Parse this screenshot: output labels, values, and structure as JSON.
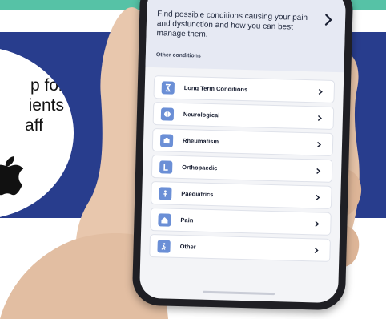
{
  "badge": {
    "lines": [
      "p for",
      "ients",
      "aff"
    ],
    "icon": "apple-logo-icon"
  },
  "phone": {
    "top_card_text": "Find possible conditions causing your pain and dysfunction and how you can best manage them.",
    "section_label": "Other conditions",
    "items": [
      {
        "label": "Long Term Conditions",
        "icon": "hourglass-icon"
      },
      {
        "label": "Neurological",
        "icon": "brain-icon"
      },
      {
        "label": "Rheumatism",
        "icon": "medical-kit-icon"
      },
      {
        "label": "Orthopaedic",
        "icon": "bone-icon"
      },
      {
        "label": "Paediatrics",
        "icon": "child-icon"
      },
      {
        "label": "Pain",
        "icon": "home-icon"
      },
      {
        "label": "Other",
        "icon": "person-walking-icon"
      }
    ]
  },
  "colors": {
    "navy": "#283d8d",
    "teal": "#56c2a6",
    "icon_blue": "#6b8fd6",
    "skin": "#e8c7ad"
  }
}
